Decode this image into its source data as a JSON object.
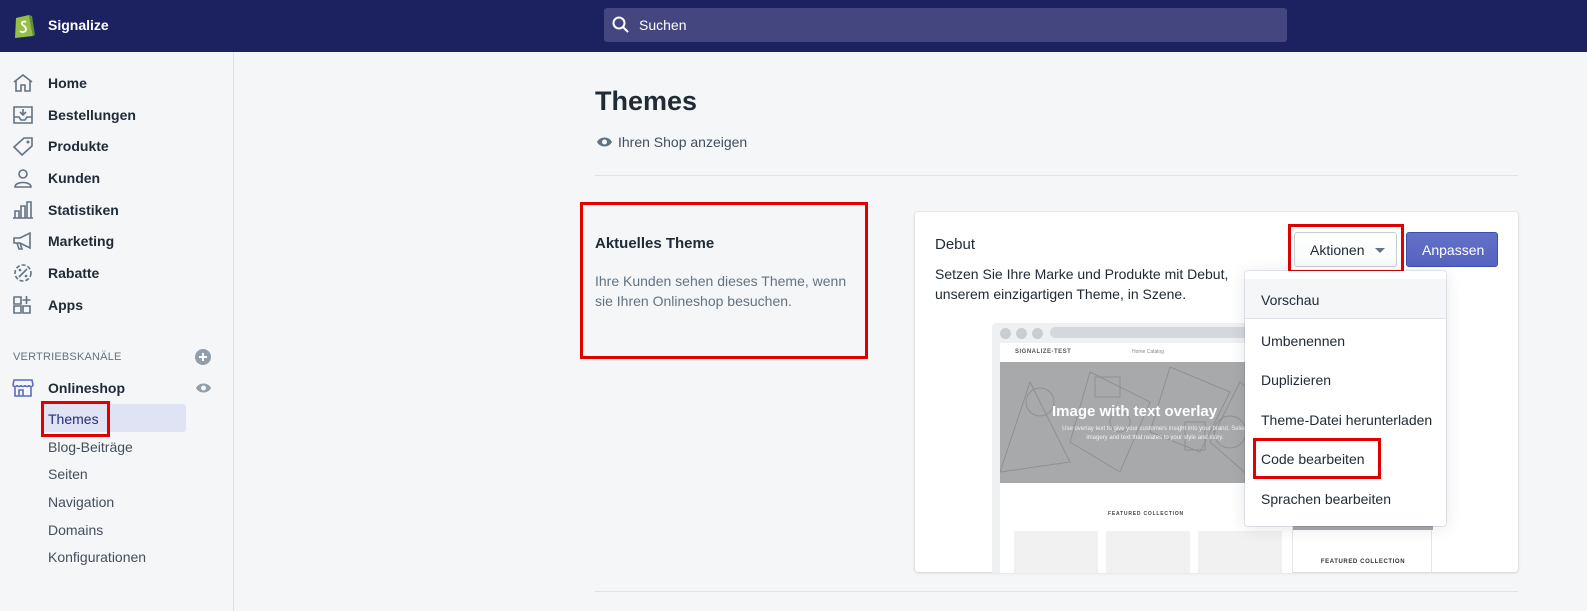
{
  "topbar": {
    "store_name": "Signalize",
    "search_placeholder": "Suchen"
  },
  "sidebar": {
    "items": [
      {
        "label": "Home",
        "icon": "home-icon"
      },
      {
        "label": "Bestellungen",
        "icon": "orders-icon"
      },
      {
        "label": "Produkte",
        "icon": "tag-icon"
      },
      {
        "label": "Kunden",
        "icon": "person-icon"
      },
      {
        "label": "Statistiken",
        "icon": "bar-chart-icon"
      },
      {
        "label": "Marketing",
        "icon": "megaphone-icon"
      },
      {
        "label": "Rabatte",
        "icon": "discount-icon"
      },
      {
        "label": "Apps",
        "icon": "apps-icon"
      }
    ],
    "sales_channels_title": "VERTRIEBSKANÄLE",
    "online_store": {
      "label": "Onlineshop",
      "sub_items": [
        "Themes",
        "Blog-Beiträge",
        "Seiten",
        "Navigation",
        "Domains",
        "Konfigurationen"
      ],
      "active": "Themes"
    }
  },
  "main": {
    "title": "Themes",
    "view_shop": "Ihren Shop anzeigen",
    "current_theme": {
      "heading": "Aktuelles Theme",
      "description": "Ihre Kunden sehen dieses Theme, wenn sie Ihren Onlineshop besuchen."
    },
    "theme_card": {
      "name": "Debut",
      "description": "Setzen Sie Ihre Marke und Produkte mit Debut, unserem einzigartigen Theme, in Szene.",
      "actions_label": "Aktionen",
      "customize_label": "Anpassen",
      "actions_menu": [
        "Vorschau",
        "Umbenennen",
        "Duplizieren",
        "Theme-Datei herunterladen",
        "Code bearbeiten",
        "Sprachen bearbeiten"
      ]
    },
    "preview": {
      "brand": "SIGNALIZE-TEST",
      "nav": "Home   Catalog",
      "hero_title": "Image with text overlay",
      "hero_subtitle": "Use overlay text to give your customers insight into your brand. Select imagery and text that relates to your style and story.",
      "featured": "FEATURED COLLECTION",
      "mobile_featured": "FEATURED COLLECTION"
    }
  },
  "colors": {
    "topbar": "#1c2260",
    "primary_button": "#5c6ac4",
    "highlight_box": "#e00000"
  }
}
